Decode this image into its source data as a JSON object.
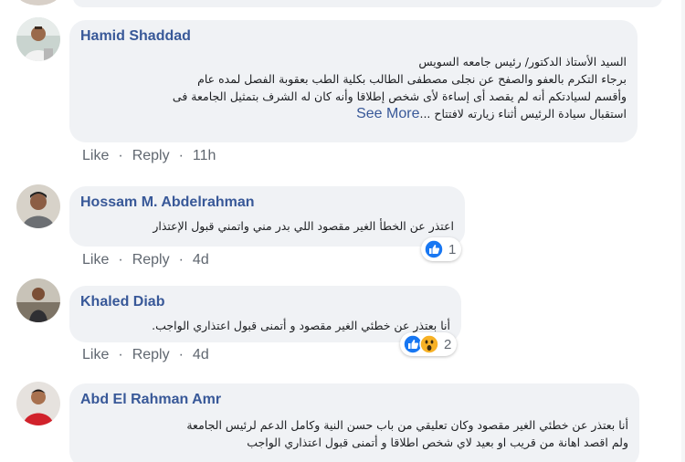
{
  "comments": [
    {
      "author": "Hamid Shaddad",
      "lines": [
        "السيد الأستاذ الدكتور/ رئيس جامعه السويس",
        "برجاء التكرم بالعفو والصفح عن نجلى مصطفى الطالب بكلية الطب بعقوبة الفصل لمده عام",
        "وأقسم لسيادتكم أنه لم يقصد أى إساءة لأى شخص إطلاقا وأنه كان له الشرف بتمثيل الجامعة فى",
        "استقبال سيادة الرئيس أثناء زيارته لافتتاح"
      ],
      "ellipsis": "...",
      "see_more": "See More",
      "like": "Like",
      "reply": "Reply",
      "time": "11h"
    },
    {
      "author": "Hossam M. Abdelrahman",
      "lines": [
        "اعتذر عن الخطأ الغير مقصود اللي بدر مني واتمني قبول الإعتذار"
      ],
      "like": "Like",
      "reply": "Reply",
      "time": "4d",
      "reaction_count": "1",
      "reactions": [
        "like-icon"
      ]
    },
    {
      "author": "Khaled Diab",
      "lines": [
        "أنا بعتذر عن خطئي الغير مقصود و أتمنى قبول اعتذاري الواجب."
      ],
      "like": "Like",
      "reply": "Reply",
      "time": "4d",
      "reaction_count": "2",
      "reactions": [
        "like-icon",
        "wow-icon"
      ]
    },
    {
      "author": "Abd El Rahman Amr",
      "lines": [
        "أنا بعتذر عن خطئي الغير مقصود وكان تعليقي من باب حسن النية وكامل الدعم لرئيس الجامعة",
        "ولم اقصد اهانة من قريب او بعيد لاي شخص اطلاقا و أتمنى قبول اعتذاري الواجب"
      ]
    }
  ],
  "colors": {
    "bubble": "#f0f2f5",
    "author": "#385898",
    "meta": "#606770",
    "like_blue": "#1877f2",
    "wow_yellow": "#f7b125"
  }
}
